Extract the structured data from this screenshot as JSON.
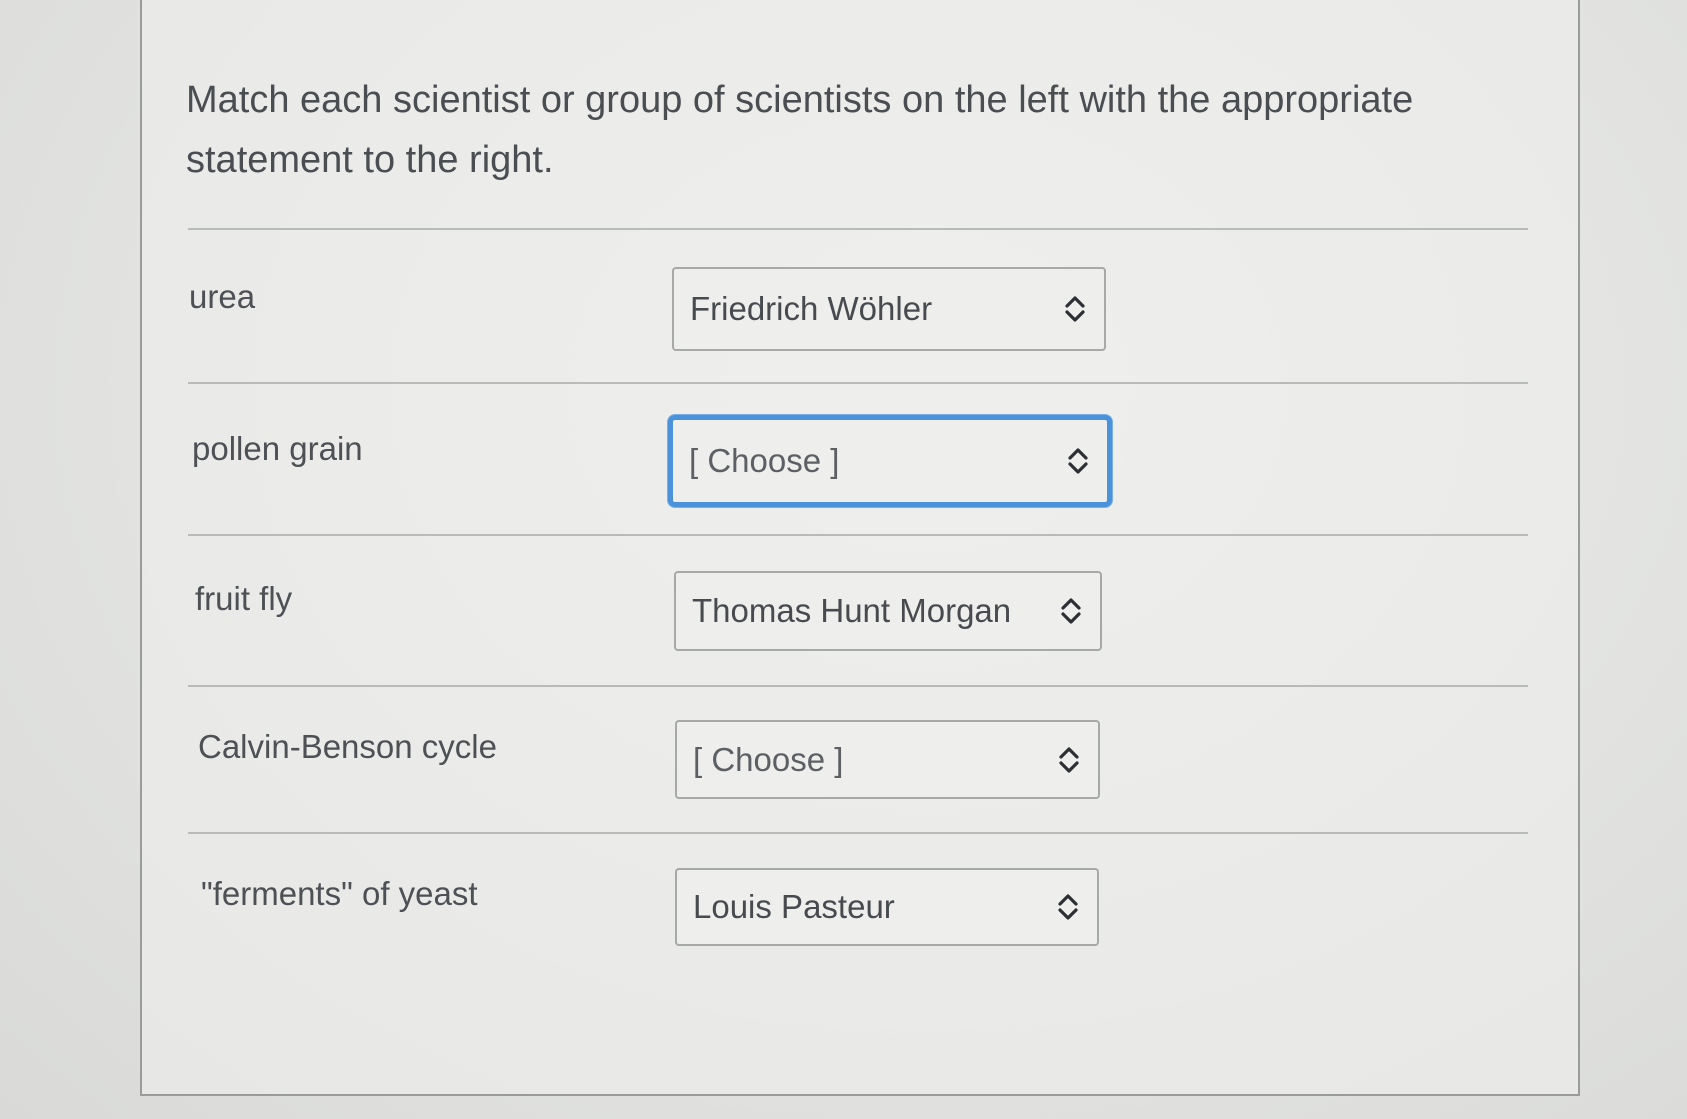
{
  "question": {
    "line1": "Match each scientist or group of scientists on the left with the appropriate",
    "line2": "statement to the right."
  },
  "rows": [
    {
      "label": "urea",
      "selected": "Friedrich Wöhler"
    },
    {
      "label": "pollen grain",
      "selected": "[ Choose ]"
    },
    {
      "label": "fruit fly",
      "selected": "Thomas Hunt Morgan"
    },
    {
      "label": "Calvin-Benson cycle",
      "selected": "[ Choose ]"
    },
    {
      "label": "\"ferments\" of yeast",
      "selected": "Louis Pasteur"
    }
  ],
  "icons": {
    "select_chevron": "chevron-up-down-icon"
  },
  "colors": {
    "focus_ring": "#4a92da",
    "text": "#4a4d51",
    "border": "#a7a9a8"
  }
}
